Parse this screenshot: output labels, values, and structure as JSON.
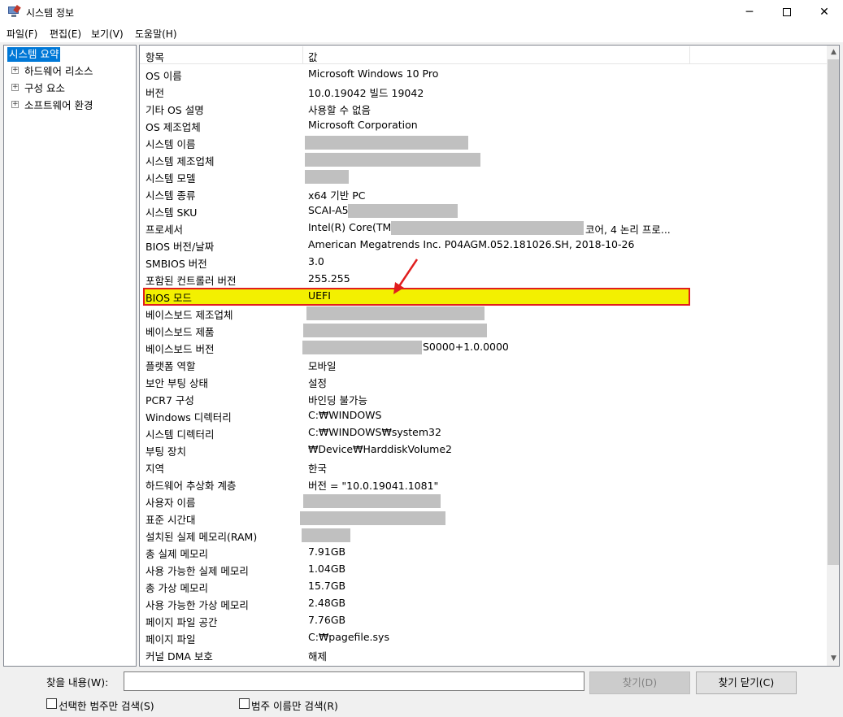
{
  "window": {
    "title": "시스템 정보",
    "controls": {
      "minimize": "─",
      "close": "✕"
    }
  },
  "menu": [
    "파일(F)",
    "편집(E)",
    "보기(V)",
    "도움말(H)"
  ],
  "tree": {
    "root": "시스템 요약",
    "children": [
      {
        "label": "하드웨어 리소스",
        "expander": "+"
      },
      {
        "label": "구성 요소",
        "expander": "+"
      },
      {
        "label": "소프트웨어 환경",
        "expander": "+"
      }
    ]
  },
  "grid": {
    "headers": {
      "item": "항목",
      "value": "값"
    },
    "rows": [
      {
        "name": "OS 이름",
        "value": "Microsoft Windows 10 Pro"
      },
      {
        "name": "버전",
        "value": "10.0.19042 빌드 19042"
      },
      {
        "name": "기타 OS 설명",
        "value": "사용할 수 없음"
      },
      {
        "name": "OS 제조업체",
        "value": "Microsoft Corporation"
      },
      {
        "name": "시스템 이름",
        "value": ""
      },
      {
        "name": "시스템 제조업체",
        "value": ""
      },
      {
        "name": "시스템 모델",
        "value": ""
      },
      {
        "name": "시스템 종류",
        "value": "x64 기반 PC"
      },
      {
        "name": "시스템 SKU",
        "value": "SCAI-A5"
      },
      {
        "name": "프로세서",
        "value": "Intel(R) Core(TM)",
        "value_suffix": "코어, 4 논리 프로..."
      },
      {
        "name": "BIOS 버전/날짜",
        "value": "American Megatrends Inc. P04AGM.052.181026.SH, 2018-10-26"
      },
      {
        "name": "SMBIOS 버전",
        "value": "3.0"
      },
      {
        "name": "포함된 컨트롤러 버전",
        "value": "255.255"
      },
      {
        "name": "BIOS 모드",
        "value": "UEFI",
        "highlighted": true
      },
      {
        "name": "베이스보드 제조업체",
        "value": ""
      },
      {
        "name": "베이스보드 제품",
        "value": ""
      },
      {
        "name": "베이스보드 버전",
        "value": "",
        "value_suffix": "S0000+1.0.0000"
      },
      {
        "name": "플랫폼 역할",
        "value": "모바일"
      },
      {
        "name": "보안 부팅 상태",
        "value": "설정"
      },
      {
        "name": "PCR7 구성",
        "value": "바인딩 불가능"
      },
      {
        "name": "Windows 디렉터리",
        "value": "C:₩WINDOWS"
      },
      {
        "name": "시스템 디렉터리",
        "value": "C:₩WINDOWS₩system32"
      },
      {
        "name": "부팅 장치",
        "value": "₩Device₩HarddiskVolume2"
      },
      {
        "name": "지역",
        "value": "한국"
      },
      {
        "name": "하드웨어 추상화 계층",
        "value": "버전 = \"10.0.19041.1081\""
      },
      {
        "name": "사용자 이름",
        "value": ""
      },
      {
        "name": "표준 시간대",
        "value": ""
      },
      {
        "name": "설치된 실제 메모리(RAM)",
        "value": ""
      },
      {
        "name": "총 실제 메모리",
        "value": "7.91GB"
      },
      {
        "name": "사용 가능한 실제 메모리",
        "value": "1.04GB"
      },
      {
        "name": "총 가상 메모리",
        "value": "15.7GB"
      },
      {
        "name": "사용 가능한 가상 메모리",
        "value": "2.48GB"
      },
      {
        "name": "페이지 파일 공간",
        "value": "7.76GB"
      },
      {
        "name": "페이지 파일",
        "value": "C:₩pagefile.sys"
      },
      {
        "name": "커널 DMA 보호",
        "value": "해제"
      }
    ]
  },
  "scrollbar": {
    "up": "▲",
    "down": "▼"
  },
  "find": {
    "label": "찾을 내용(W):",
    "value": "",
    "find_button": "찾기(D)",
    "close_button": "찾기 닫기(C)",
    "checkbox_selected_category": "선택한 범주만 검색(S)",
    "checkbox_category_names": "범주 이름만 검색(R)"
  },
  "colors": {
    "highlight_fill": "#f3f000",
    "highlight_border": "#e01e1e",
    "selection": "#0078d7",
    "redaction": "#c0c0c0"
  }
}
